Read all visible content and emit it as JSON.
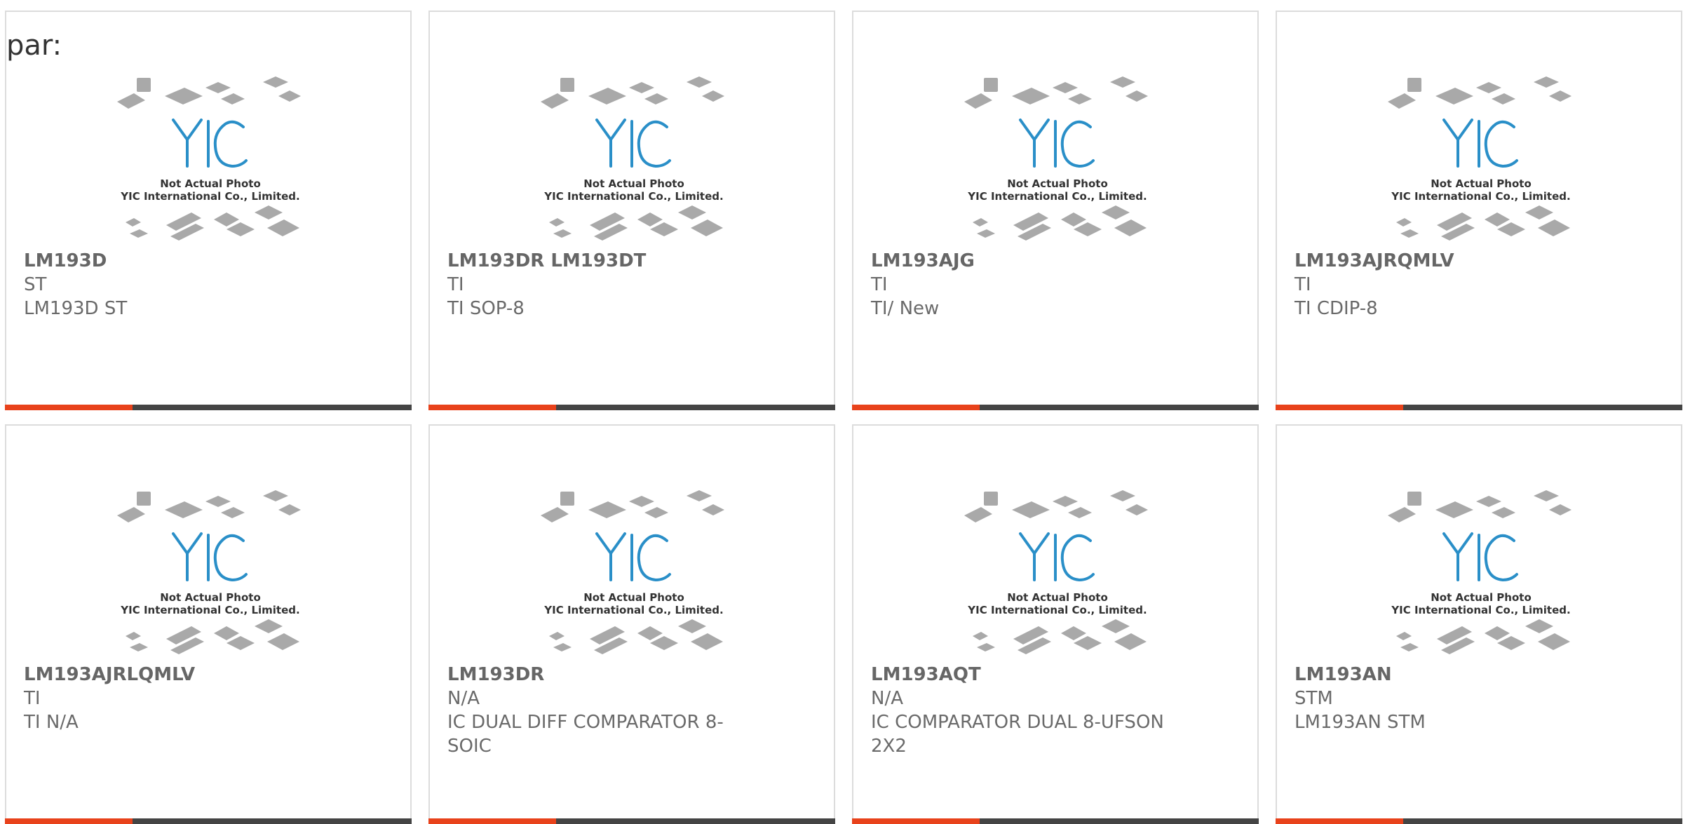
{
  "page_prefix": "par:",
  "thumbnail": {
    "caption_line1": "Not Actual Photo",
    "caption_line2": "YIC International Co., Limited.",
    "logo_text": "YIC",
    "logo_color": "#2a8fc8",
    "chip_color": "#a9a9a9"
  },
  "accent_color": "#e8421b",
  "bar_color": "#444444",
  "products": [
    {
      "part": "LM193D",
      "maker": "ST",
      "desc": "LM193D ST"
    },
    {
      "part": "LM193DR LM193DT",
      "maker": "TI",
      "desc": "TI SOP-8"
    },
    {
      "part": "LM193AJG",
      "maker": "TI",
      "desc": "TI/ New"
    },
    {
      "part": "LM193AJRQMLV",
      "maker": "TI",
      "desc": "TI CDIP-8"
    },
    {
      "part": "LM193AJRLQMLV",
      "maker": "TI",
      "desc": "TI N/A"
    },
    {
      "part": "LM193DR",
      "maker": "N/A",
      "desc": "IC DUAL DIFF COMPARATOR 8-SOIC"
    },
    {
      "part": "LM193AQT",
      "maker": "N/A",
      "desc": "IC COMPARATOR DUAL 8-UFSON 2X2"
    },
    {
      "part": "LM193AN",
      "maker": "STM",
      "desc": "LM193AN STM"
    }
  ]
}
